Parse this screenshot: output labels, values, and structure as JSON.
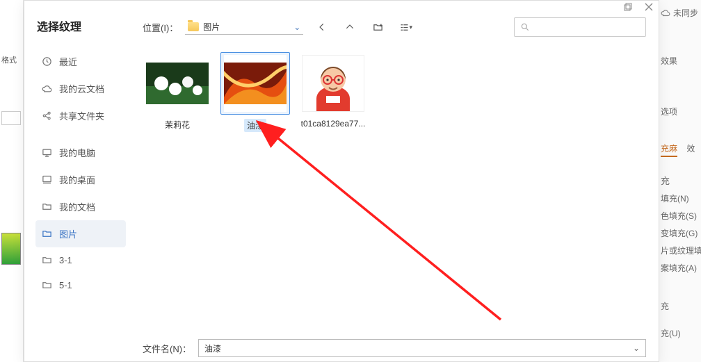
{
  "bg": {
    "top_left_label": "格式",
    "sync_label": "未同步",
    "right_lines": [
      "效果",
      "选项"
    ],
    "right_tabs": [
      "充麻",
      "效"
    ],
    "right_heading": "充",
    "right_fill_options": [
      "填充(N)",
      "色填充(S)",
      "变填充(G)",
      "片或纹理填",
      "案填充(A)"
    ],
    "right_more": [
      "充",
      "充(U)"
    ]
  },
  "dialog": {
    "title": "选择纹理",
    "location_label": "位置(I)：",
    "location_value": "图片",
    "filename_label": "文件名(N)：",
    "filename_value": "油漆"
  },
  "sidebar": {
    "items": [
      {
        "id": "recent",
        "label": "最近"
      },
      {
        "id": "cloud",
        "label": "我的云文档"
      },
      {
        "id": "shared",
        "label": "共享文件夹"
      },
      {
        "id": "computer",
        "label": "我的电脑"
      },
      {
        "id": "desktop",
        "label": "我的桌面"
      },
      {
        "id": "docs",
        "label": "我的文档"
      },
      {
        "id": "pictures",
        "label": "图片",
        "active": true
      },
      {
        "id": "folder31",
        "label": "3-1"
      },
      {
        "id": "folder51",
        "label": "5-1"
      }
    ]
  },
  "files": [
    {
      "id": "flower",
      "label": "茉莉花"
    },
    {
      "id": "paint",
      "label": "油漆",
      "selected": true
    },
    {
      "id": "avatar",
      "label": "t01ca8129ea77..."
    }
  ]
}
